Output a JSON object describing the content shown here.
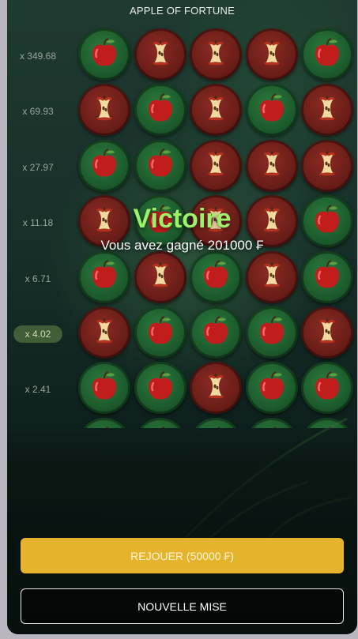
{
  "game": {
    "title": "APPLE OF FORTUNE",
    "multipliers": [
      {
        "label": "x 349.68",
        "active": false
      },
      {
        "label": "x 69.93",
        "active": false
      },
      {
        "label": "x 27.97",
        "active": false
      },
      {
        "label": "x 11.18",
        "active": false
      },
      {
        "label": "x 6.71",
        "active": false
      },
      {
        "label": "x 4.02",
        "active": true
      },
      {
        "label": "x 2.41",
        "active": false
      }
    ],
    "grid": [
      [
        "apple",
        "core",
        "core",
        "core",
        "apple"
      ],
      [
        "core",
        "apple",
        "core",
        "apple",
        "core"
      ],
      [
        "apple",
        "apple",
        "core",
        "core",
        "core"
      ],
      [
        "core",
        "apple",
        "core",
        "core",
        "apple"
      ],
      [
        "apple",
        "core",
        "apple",
        "core",
        "apple"
      ],
      [
        "core",
        "apple",
        "apple",
        "apple",
        "core"
      ],
      [
        "apple",
        "apple",
        "core",
        "apple",
        "apple"
      ],
      [
        "apple",
        "apple",
        "apple",
        "apple",
        "apple"
      ]
    ],
    "result": {
      "title": "Victoire",
      "message": "Vous avez gagné 201000 ₣"
    },
    "buttons": {
      "replay": "REJOUER (50000 ₣)",
      "new_bet": "NOUVELLE MISE"
    },
    "colors": {
      "accent": "#e5b42c",
      "victory": "#9cf06a"
    }
  }
}
